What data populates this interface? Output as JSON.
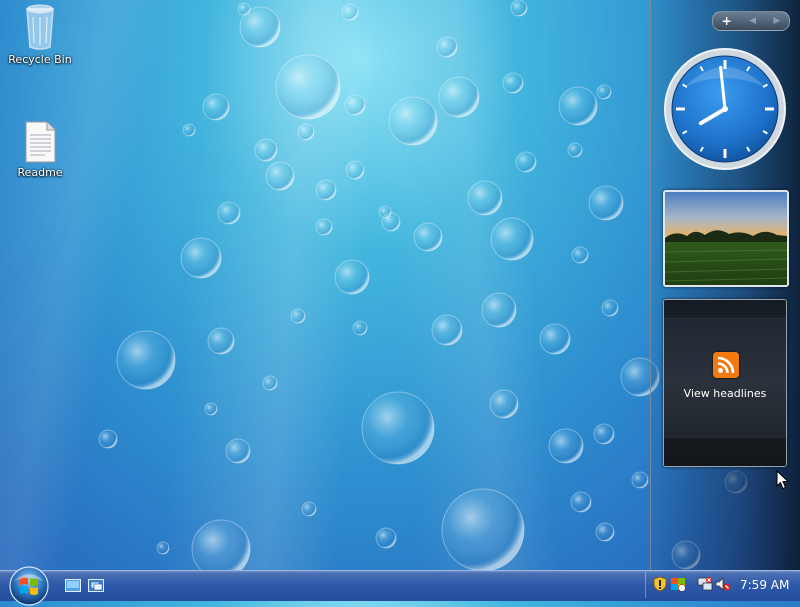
{
  "desktop": {
    "icons": [
      {
        "label": "Recycle Bin",
        "icon": "recycle-bin-icon"
      },
      {
        "label": "Readme",
        "icon": "document-icon"
      }
    ]
  },
  "sidebar": {
    "controls": {
      "add": "+",
      "prev": "◀",
      "next": "▶"
    },
    "clock_gadget": {
      "hour": 7,
      "minute": 59
    },
    "slideshow_gadget": {
      "icon": "landscape-photo"
    },
    "feed_gadget": {
      "label": "View headlines",
      "icon": "rss-icon"
    }
  },
  "taskbar": {
    "start_icon": "windows-logo-icon",
    "quick_launch": [
      "show-desktop-icon",
      "switch-windows-icon"
    ],
    "tray_icons": [
      "security-shield-icon",
      "flag-icon",
      "network-icon",
      "volume-muted-icon"
    ],
    "time": "7:59 AM"
  },
  "colors": {
    "taskbar": "#2d58a8",
    "clock_face": "#1c6fc7",
    "rss": "#f07a10"
  }
}
